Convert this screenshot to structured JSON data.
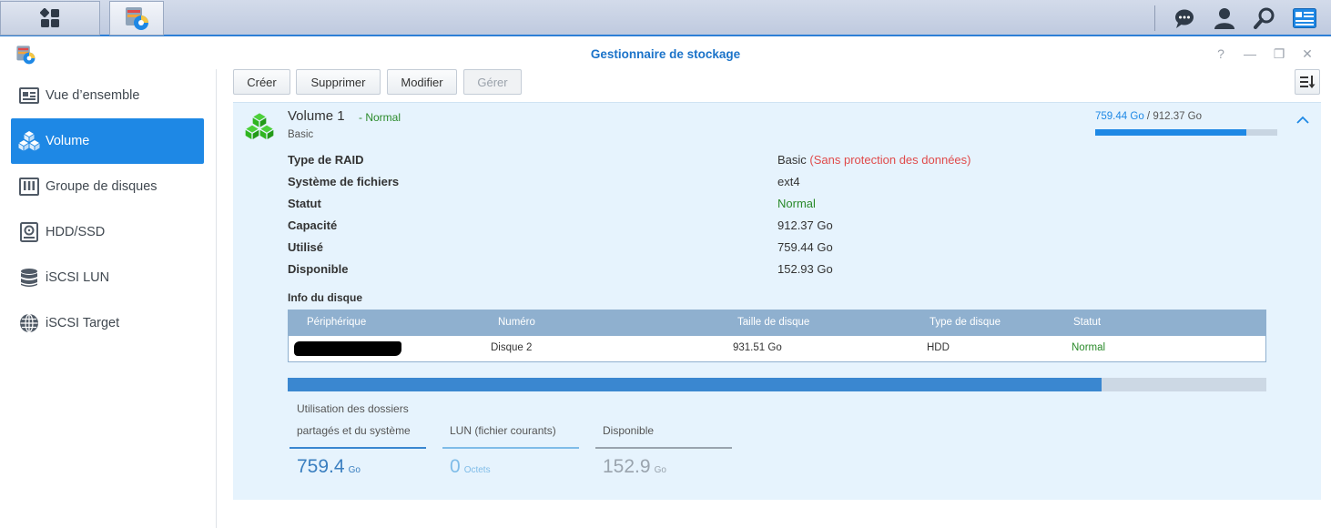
{
  "taskbar": {
    "apps_icon": "grid-apps-icon",
    "storage_icon": "storage-manager-icon",
    "right_icons": [
      "chat-icon",
      "user-icon",
      "search-icon",
      "widgets-icon"
    ]
  },
  "window": {
    "title": "Gestionnaire de stockage",
    "controls": {
      "help": "?",
      "minimize": "—",
      "restore": "❐",
      "close": "✕"
    }
  },
  "sidebar": {
    "items": [
      {
        "label": "Vue d’ensemble",
        "icon": "overview-icon",
        "active": false
      },
      {
        "label": "Volume",
        "icon": "volume-cubes-icon",
        "active": true
      },
      {
        "label": "Groupe de disques",
        "icon": "disk-group-icon",
        "active": false
      },
      {
        "label": "HDD/SSD",
        "icon": "hdd-icon",
        "active": false
      },
      {
        "label": "iSCSI LUN",
        "icon": "database-icon",
        "active": false
      },
      {
        "label": "iSCSI Target",
        "icon": "globe-icon",
        "active": false
      }
    ]
  },
  "toolbar": {
    "create": "Créer",
    "delete": "Supprimer",
    "modify": "Modifier",
    "manage": "Gérer",
    "sort_icon": "sort-icon"
  },
  "volume": {
    "name": "Volume 1",
    "status_sep": " - ",
    "status": "Normal",
    "type": "Basic",
    "used": "759.44 Go",
    "separator": " / ",
    "total": "912.37 Go",
    "usage_fraction": 0.832,
    "properties": [
      {
        "label": "Type de RAID",
        "value": "Basic",
        "note": "(Sans protection des données)"
      },
      {
        "label": "Système de fichiers",
        "value": "ext4"
      },
      {
        "label": "Statut",
        "value": "Normal"
      },
      {
        "label": "Capacité",
        "value": "912.37 Go"
      },
      {
        "label": "Utilisé",
        "value": "759.44 Go"
      },
      {
        "label": "Disponible",
        "value": "152.93 Go"
      }
    ]
  },
  "disk_info": {
    "title": "Info du disque",
    "columns": [
      "Périphérique",
      "Numéro",
      "Taille de disque",
      "Type de disque",
      "Statut"
    ],
    "rows": [
      {
        "device": "",
        "number": "Disque 2",
        "size": "931.51 Go",
        "type": "HDD",
        "status": "Normal"
      }
    ]
  },
  "usage_breakdown": {
    "bar_fraction": 0.832,
    "items": [
      {
        "label_line1": "Utilisation des dossiers",
        "label_line2": "partagés et du système",
        "value": "759.4",
        "unit": "Go",
        "color": "#3a87d0"
      },
      {
        "label_line1": "",
        "label_line2": "LUN (fichier courants)",
        "value": "0",
        "unit": "Octets",
        "color": "#7fbce8"
      },
      {
        "label_line1": "",
        "label_line2": "Disponible",
        "value": "152.9",
        "unit": "Go",
        "color": "#9aa4ae"
      }
    ]
  },
  "colors": {
    "accent": "#1e88e5",
    "ok": "#2a8a2a",
    "warn": "#e04a4a",
    "panel_bg": "#e6f3fd"
  }
}
